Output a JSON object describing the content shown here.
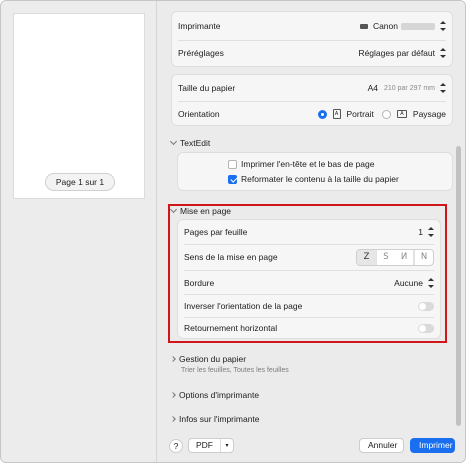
{
  "preview": {
    "page_label": "Page 1 sur 1"
  },
  "printer": {
    "label": "Imprimante",
    "value": "Canon"
  },
  "presets": {
    "label": "Préréglages",
    "value": "Réglages par défaut"
  },
  "paper_size": {
    "label": "Taille du papier",
    "value": "A4",
    "dimensions": "210 par 297 mm"
  },
  "orientation": {
    "label": "Orientation",
    "portrait": "Portrait",
    "landscape": "Paysage",
    "selected": "Portrait"
  },
  "textedit": {
    "header": "TextEdit",
    "header_footer_label": "Imprimer l'en-tête et le bas de page",
    "header_footer_checked": false,
    "rewrap_label": "Reformater le contenu à la taille du papier",
    "rewrap_checked": true
  },
  "layout": {
    "header": "Mise en page",
    "pages_per_sheet_label": "Pages par feuille",
    "pages_per_sheet_value": "1",
    "direction_label": "Sens de la mise en page",
    "direction_options": [
      "Z",
      "S",
      "N",
      "N"
    ],
    "border_label": "Bordure",
    "border_value": "Aucune",
    "reverse_orientation_label": "Inverser l'orientation de la page",
    "reverse_orientation_on": false,
    "flip_horizontal_label": "Retournement horizontal",
    "flip_horizontal_on": false
  },
  "paper_handling": {
    "header": "Gestion du papier",
    "subtitle": "Trier les feuilles, Toutes les feuilles"
  },
  "printer_options": {
    "header": "Options d'imprimante"
  },
  "printer_info": {
    "header": "Infos sur l'imprimante"
  },
  "footer": {
    "help": "?",
    "pdf": "PDF",
    "cancel": "Annuler",
    "print": "Imprimer"
  },
  "colors": {
    "accent": "#1a6ff0",
    "highlight_border": "#d0151b"
  }
}
